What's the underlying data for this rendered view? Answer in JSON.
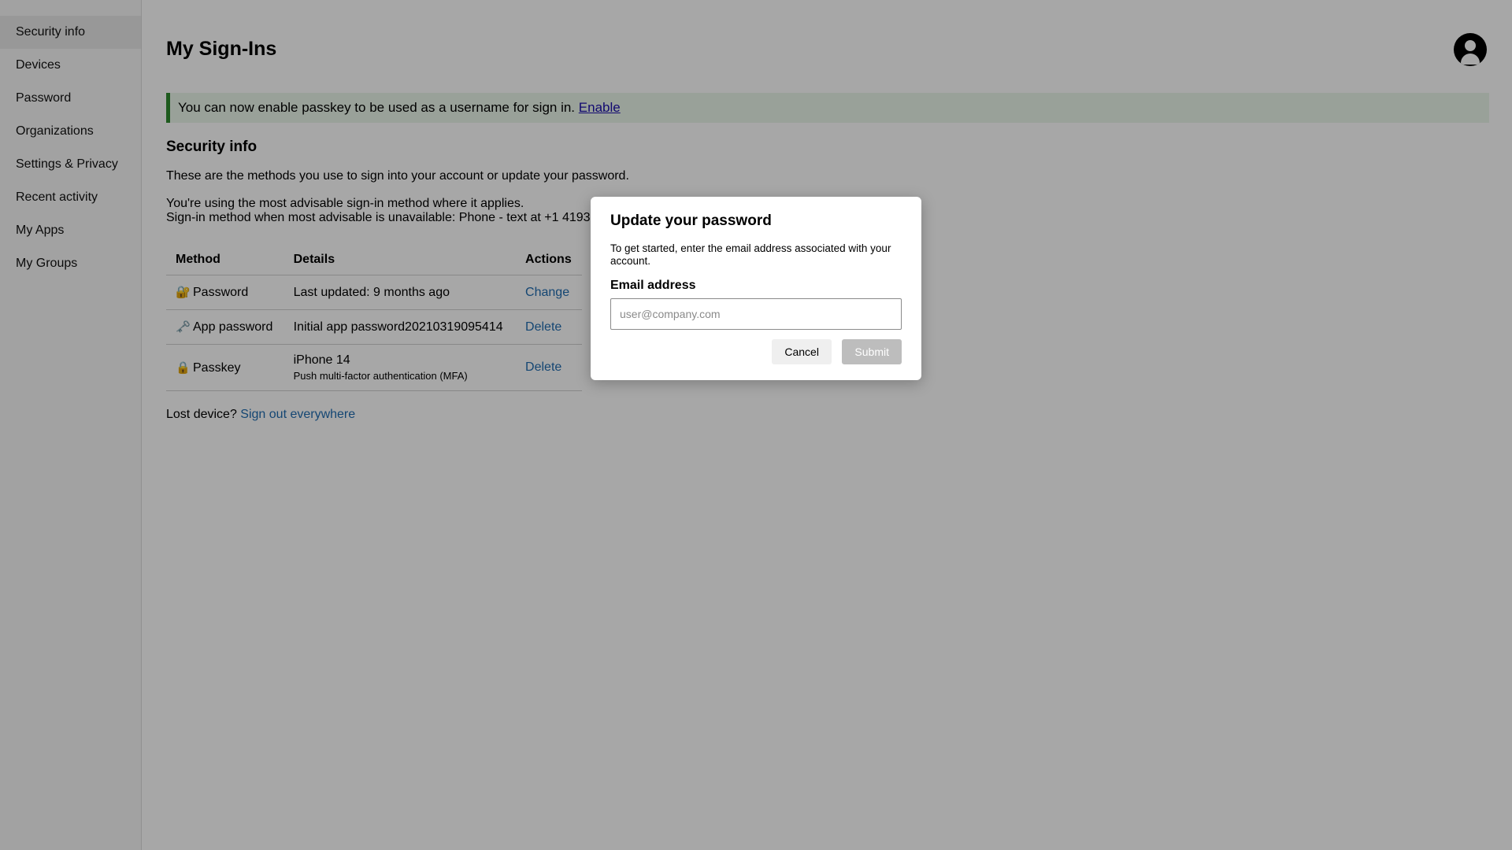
{
  "sidebar": {
    "items": [
      {
        "label": "Security info",
        "active": true
      },
      {
        "label": "Devices"
      },
      {
        "label": "Password"
      },
      {
        "label": "Organizations"
      },
      {
        "label": "Settings & Privacy"
      },
      {
        "label": "Recent activity"
      },
      {
        "label": "My Apps"
      },
      {
        "label": "My Groups"
      }
    ]
  },
  "header": {
    "title": "My Sign-Ins",
    "avatar_icon": "user-circle-icon"
  },
  "banner": {
    "text": "You can now enable passkey to be used as a username for sign in.",
    "link": "Enable",
    "accent_color": "#2f8a2f"
  },
  "security": {
    "title": "Security info",
    "description": "These are the methods you use to sign into your account or update your password.",
    "advice_line1": "You're using the most advisable sign-in method where it applies.",
    "advice_line2": "Sign-in method when most advisable is unavailable: Phone - text at +1 4193"
  },
  "table": {
    "headers": [
      "Method",
      "Details",
      "Actions"
    ],
    "rows": [
      {
        "icon": "🔐",
        "icon_name": "lock-with-key-icon",
        "method": "Password",
        "details": "Last updated: 9 months ago",
        "details_sub": "",
        "action": "Change"
      },
      {
        "icon": "🗝️",
        "icon_name": "key-icon",
        "method": "App password",
        "details": "Initial app password20210319095414",
        "details_sub": "",
        "action": "Delete"
      },
      {
        "icon": "🔒",
        "icon_name": "lock-icon",
        "method": "Passkey",
        "details": "iPhone 14",
        "details_sub": "Push multi-factor authentication (MFA)",
        "action": "Delete"
      }
    ]
  },
  "lost_device": {
    "text": "Lost device?",
    "link": "Sign out everywhere"
  },
  "dialog": {
    "title": "Update your password",
    "description": "To get started, enter the email address associated with your account.",
    "field_label": "Email address",
    "email_value": "",
    "email_placeholder": "user@company.com",
    "cancel_label": "Cancel",
    "submit_label": "Submit"
  }
}
